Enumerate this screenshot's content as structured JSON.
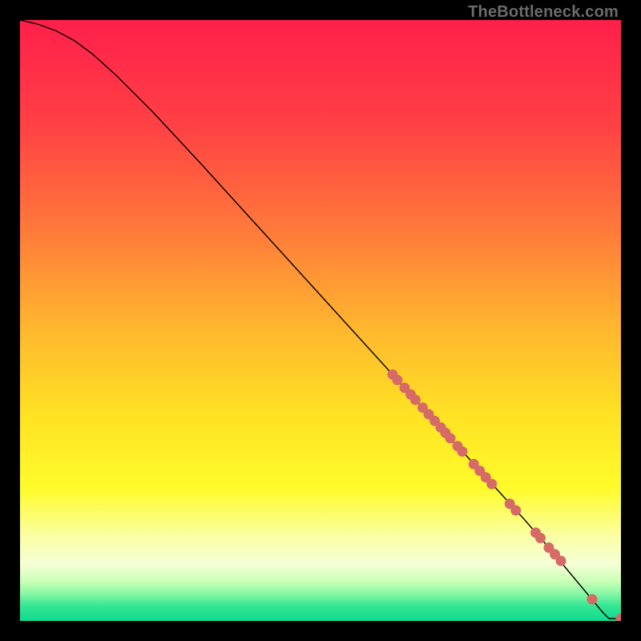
{
  "watermark": "TheBottleneck.com",
  "chart_data": {
    "type": "line",
    "title": "",
    "xlabel": "",
    "ylabel": "",
    "xlim": [
      0,
      100
    ],
    "ylim": [
      0,
      100
    ],
    "grid": false,
    "background_gradient_stops": [
      {
        "offset": 0.0,
        "color": "#ff1f4b"
      },
      {
        "offset": 0.18,
        "color": "#ff4244"
      },
      {
        "offset": 0.35,
        "color": "#ff7a3a"
      },
      {
        "offset": 0.52,
        "color": "#ffb92e"
      },
      {
        "offset": 0.66,
        "color": "#ffe324"
      },
      {
        "offset": 0.78,
        "color": "#fffb2b"
      },
      {
        "offset": 0.86,
        "color": "#fbffa6"
      },
      {
        "offset": 0.905,
        "color": "#f5ffd6"
      },
      {
        "offset": 0.935,
        "color": "#c8ffb5"
      },
      {
        "offset": 0.955,
        "color": "#86f7a4"
      },
      {
        "offset": 0.975,
        "color": "#34e693"
      },
      {
        "offset": 1.0,
        "color": "#11d98f"
      }
    ],
    "series": [
      {
        "name": "curve",
        "style": "line",
        "color": "#000000",
        "width": 1.4,
        "x": [
          0,
          3,
          6,
          9,
          12,
          16,
          22,
          30,
          40,
          50,
          60,
          70,
          78,
          84,
          88,
          91,
          93.5,
          95.5,
          97,
          98,
          100
        ],
        "y": [
          100,
          99.3,
          98.2,
          96.6,
          94.4,
          90.8,
          84.8,
          76.2,
          65.2,
          54.2,
          43.2,
          32.2,
          23.4,
          16.8,
          12.2,
          8.6,
          5.6,
          3.2,
          1.4,
          0.4,
          0.4
        ]
      },
      {
        "name": "dots",
        "style": "scatter",
        "color": "#d66a66",
        "radius": 6.5,
        "x": [
          62.0,
          62.8,
          64.0,
          65.0,
          65.8,
          67.0,
          68.0,
          69.0,
          70.0,
          70.8,
          71.6,
          72.8,
          73.6,
          75.5,
          76.5,
          77.5,
          78.5,
          81.5,
          82.5,
          85.8,
          86.6,
          88.0,
          89.0,
          90.0,
          95.2,
          100.0
        ],
        "y": [
          41.0,
          40.1,
          38.8,
          37.7,
          36.8,
          35.5,
          34.4,
          33.3,
          32.2,
          31.3,
          30.4,
          29.1,
          28.2,
          26.1,
          25.0,
          23.9,
          22.8,
          19.5,
          18.4,
          14.7,
          13.8,
          12.2,
          11.1,
          10.0,
          3.6,
          0.4
        ]
      }
    ]
  }
}
